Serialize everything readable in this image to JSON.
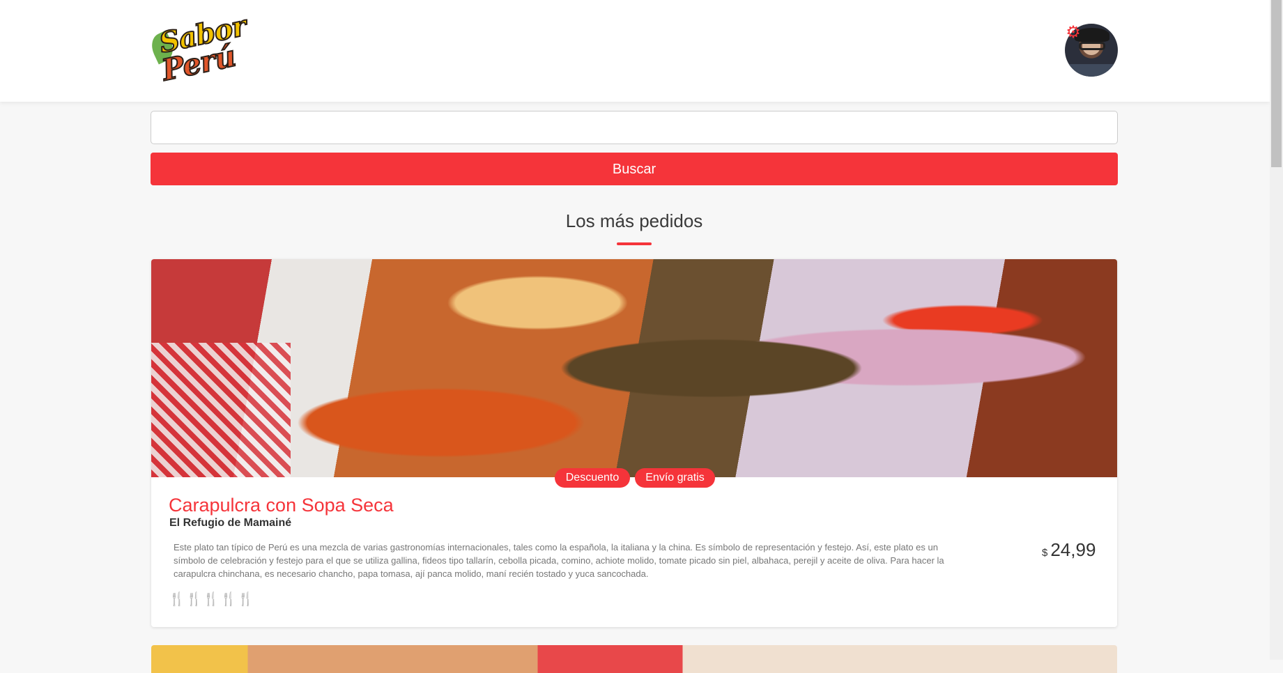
{
  "header": {
    "logo_line1": "Sabor",
    "logo_line2": "Perú",
    "settings_icon": "gear-icon",
    "avatar": "user-avatar"
  },
  "search": {
    "value": "",
    "placeholder": "",
    "button_label": "Buscar"
  },
  "section": {
    "title": "Los más pedidos"
  },
  "cards": [
    {
      "badges": [
        "Descuento",
        "Envío gratis"
      ],
      "title": "Carapulcra con Sopa Seca",
      "restaurant": "El Refugio de Mamainé",
      "description": "Este plato tan típico de Perú es una mezcla de varias gastronomías internacionales, tales como la española, la italiana y la china. Es símbolo de representación y festejo. Así, este plato es un símbolo de celebración y festejo para el que se utiliza gallina, fideos tipo tallarín, cebolla picada, comino, achiote molido, tomate picado sin piel, albahaca, perejil y aceite de oliva. Para hacer la carapulcra chinchana, es necesario chancho, papa tomasa, ají panca molido, maní recién tostado y yuca sancochada.",
      "currency": "$",
      "price": "24,99",
      "rating_icon": "fork-knife-icon",
      "rating_count": 5
    }
  ],
  "colors": {
    "accent": "#f5343a",
    "text": "#333333",
    "muted": "#777777"
  }
}
